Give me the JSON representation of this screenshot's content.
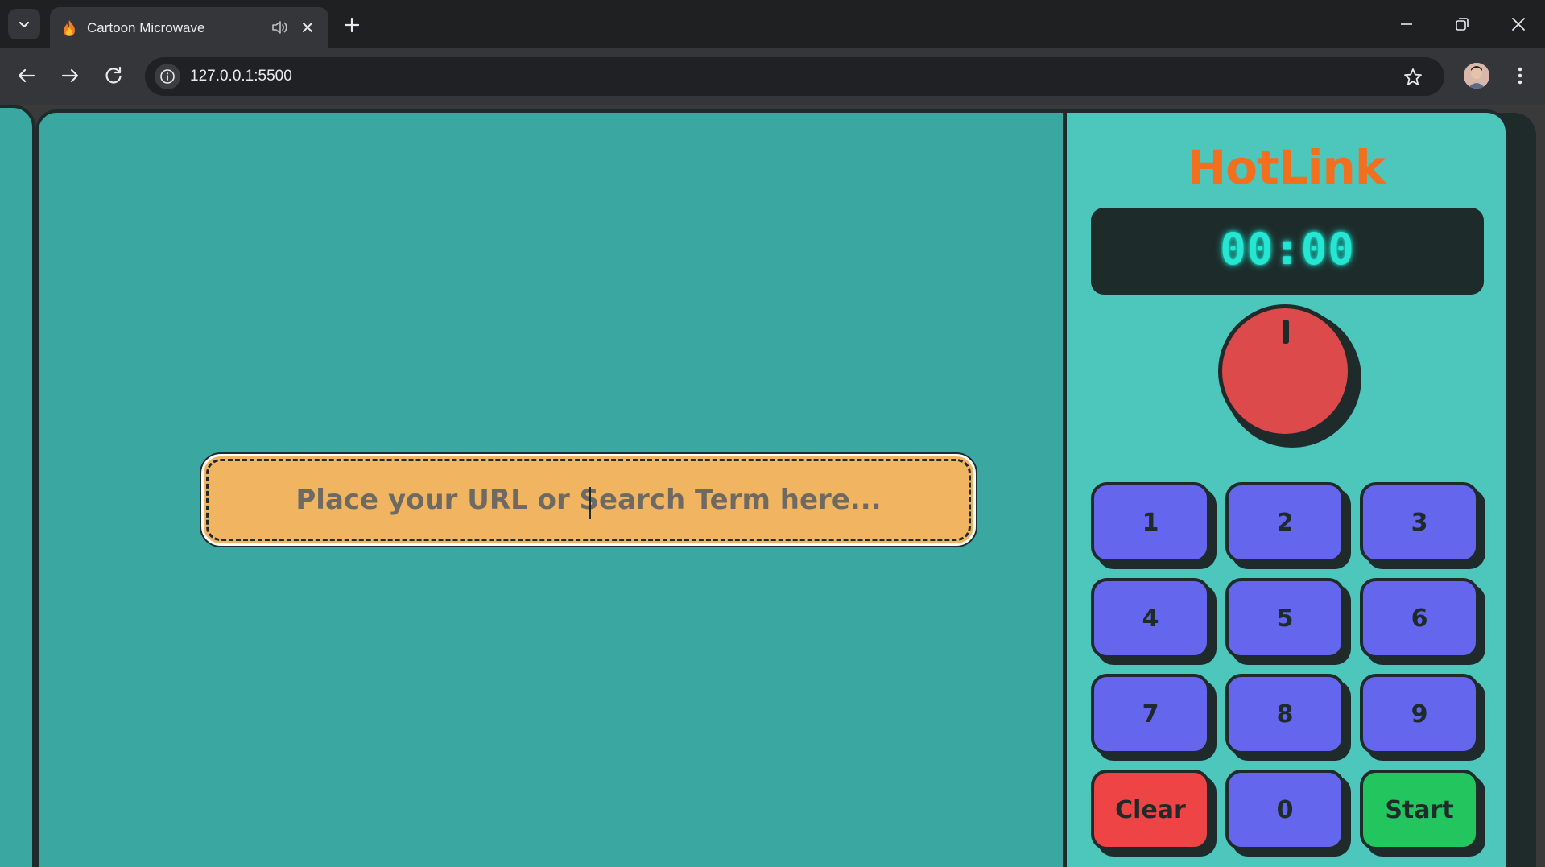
{
  "browser": {
    "tab_title": "Cartoon Microwave",
    "url": "127.0.0.1:5500",
    "icons": {
      "tab_search": "chevron-down-icon",
      "favicon": "flame-icon",
      "audio": "speaker-icon",
      "close_tab": "close-icon",
      "new_tab": "plus-icon",
      "minimize": "minimize-icon",
      "maximize": "restore-icon",
      "close_window": "close-icon",
      "back": "arrow-left-icon",
      "forward": "arrow-right-icon",
      "reload": "reload-icon",
      "site_info": "info-icon",
      "bookmark": "star-icon",
      "profile": "avatar",
      "menu": "kebab-menu-icon"
    }
  },
  "screen": {
    "search_placeholder": "Place your URL or Search Term here..."
  },
  "panel": {
    "brand": "HotLink",
    "timer": "00:00",
    "keys": [
      "1",
      "2",
      "3",
      "4",
      "5",
      "6",
      "7",
      "8",
      "9",
      "Clear",
      "0",
      "Start"
    ]
  },
  "colors": {
    "screen_bg": "#3aa8a1",
    "panel_bg": "#4dc6bc",
    "brand": "#f26f1d",
    "timer_text": "#24e6d2",
    "knob": "#dc4a4b",
    "key": "#6466ee",
    "clear_key": "#ee4446",
    "start_key": "#22c55e",
    "search_box": "#f1b562"
  }
}
